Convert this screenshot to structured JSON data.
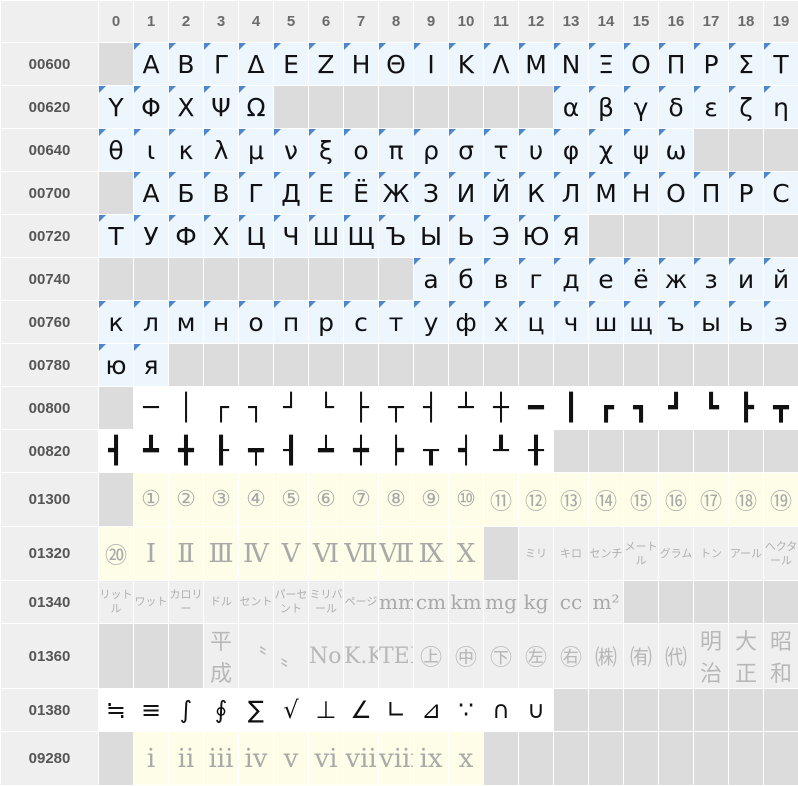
{
  "columns": [
    "0",
    "1",
    "2",
    "3",
    "4",
    "5",
    "6",
    "7",
    "8",
    "9",
    "10",
    "11",
    "12",
    "13",
    "14",
    "15",
    "16",
    "17",
    "18",
    "19"
  ],
  "rows": [
    {
      "label": "00600",
      "kind": "alt",
      "cells": [
        "",
        "Α",
        "Β",
        "Γ",
        "Δ",
        "Ε",
        "Ζ",
        "Η",
        "Θ",
        "Ι",
        "Κ",
        "Λ",
        "Μ",
        "Ν",
        "Ξ",
        "Ο",
        "Π",
        "Ρ",
        "Σ",
        "Τ"
      ]
    },
    {
      "label": "00620",
      "kind": "alt",
      "cells": [
        "Υ",
        "Φ",
        "Χ",
        "Ψ",
        "Ω",
        "",
        "",
        "",
        "",
        "",
        "",
        "",
        "",
        "α",
        "β",
        "γ",
        "δ",
        "ε",
        "ζ",
        "η"
      ]
    },
    {
      "label": "00640",
      "kind": "alt",
      "cells": [
        "θ",
        "ι",
        "κ",
        "λ",
        "μ",
        "ν",
        "ξ",
        "ο",
        "π",
        "ρ",
        "σ",
        "τ",
        "υ",
        "φ",
        "χ",
        "ψ",
        "ω",
        "",
        "",
        ""
      ]
    },
    {
      "label": "00700",
      "kind": "alt",
      "cells": [
        "",
        "А",
        "Б",
        "В",
        "Г",
        "Д",
        "Е",
        "Ё",
        "Ж",
        "З",
        "И",
        "Й",
        "К",
        "Л",
        "М",
        "Н",
        "О",
        "П",
        "Р",
        "С"
      ]
    },
    {
      "label": "00720",
      "kind": "alt",
      "cells": [
        "Т",
        "У",
        "Ф",
        "Х",
        "Ц",
        "Ч",
        "Ш",
        "Щ",
        "Ъ",
        "Ы",
        "Ь",
        "Э",
        "Ю",
        "Я",
        "",
        "",
        "",
        "",
        "",
        ""
      ]
    },
    {
      "label": "00740",
      "kind": "alt",
      "cells": [
        "",
        "",
        "",
        "",
        "",
        "",
        "",
        "",
        "",
        "а",
        "б",
        "в",
        "г",
        "д",
        "е",
        "ё",
        "ж",
        "з",
        "и",
        "й"
      ]
    },
    {
      "label": "00760",
      "kind": "alt",
      "cells": [
        "к",
        "л",
        "м",
        "н",
        "о",
        "п",
        "р",
        "с",
        "т",
        "у",
        "ф",
        "х",
        "ц",
        "ч",
        "ш",
        "щ",
        "ъ",
        "ы",
        "ь",
        "э"
      ]
    },
    {
      "label": "00780",
      "kind": "alt",
      "cells": [
        "ю",
        "я",
        "",
        "",
        "",
        "",
        "",
        "",
        "",
        "",
        "",
        "",
        "",
        "",
        "",
        "",
        "",
        "",
        "",
        ""
      ]
    },
    {
      "label": "00800",
      "kind": "box",
      "cells": [
        "",
        "─",
        "│",
        "┌",
        "┐",
        "┘",
        "└",
        "├",
        "┬",
        "┤",
        "┴",
        "┼",
        "━",
        "┃",
        "┏",
        "┓",
        "┛",
        "┗",
        "┣",
        "┳"
      ]
    },
    {
      "label": "00820",
      "kind": "box",
      "cells": [
        "┫",
        "┻",
        "╋",
        "┠",
        "┯",
        "┨",
        "┷",
        "┿",
        "┝",
        "┰",
        "┥",
        "┸",
        "╂",
        "",
        "",
        "",
        "",
        "",
        "",
        ""
      ]
    },
    {
      "label": "01300",
      "kind": "nec",
      "cells": [
        "",
        "①",
        "②",
        "③",
        "④",
        "⑤",
        "⑥",
        "⑦",
        "⑧",
        "⑨",
        "⑩",
        "⑪",
        "⑫",
        "⑬",
        "⑭",
        "⑮",
        "⑯",
        "⑰",
        "⑱",
        "⑲"
      ]
    },
    {
      "label": "01320",
      "kind": "nec",
      "cells": [
        "⑳",
        "Ⅰ",
        "Ⅱ",
        "Ⅲ",
        "Ⅳ",
        "Ⅴ",
        "Ⅵ",
        "Ⅶ",
        "Ⅷ",
        "Ⅸ",
        "Ⅹ",
        "",
        "ミリ",
        "キロ",
        "センチ",
        "メートル",
        "グラム",
        "トン",
        "アール",
        "ヘクタール"
      ]
    },
    {
      "label": "01340",
      "kind": "nec",
      "cells": [
        "リットル",
        "ワット",
        "カロリー",
        "ドル",
        "セント",
        "パーセント",
        "ミリバール",
        "ページ",
        "mm",
        "cm",
        "km",
        "mg",
        "kg",
        "cc",
        "m²",
        "",
        "",
        "",
        "",
        ""
      ]
    },
    {
      "label": "01360",
      "kind": "nec",
      "cells": [
        "",
        "",
        "",
        "平成",
        "〝",
        "〟",
        "No.",
        "K.K.",
        "TEL",
        "㊤",
        "㊥",
        "㊦",
        "㊧",
        "㊨",
        "㈱",
        "㈲",
        "㈹",
        "明治",
        "大正",
        "昭和"
      ]
    },
    {
      "label": "01380",
      "kind": "math",
      "cells": [
        "≒",
        "≡",
        "∫",
        "∮",
        "∑",
        "√",
        "⊥",
        "∠",
        "∟",
        "⊿",
        "∵",
        "∩",
        "∪",
        "",
        "",
        "",
        "",
        "",
        "",
        ""
      ]
    },
    {
      "label": "09280",
      "kind": "nec",
      "cells": [
        "",
        "ⅰ",
        "ⅱ",
        "ⅲ",
        "ⅳ",
        "ⅴ",
        "ⅵ",
        "ⅶ",
        "ⅷ",
        "ⅸ",
        "ⅹ",
        "",
        "",
        "",
        "",
        "",
        "",
        "",
        "",
        ""
      ]
    }
  ],
  "colors": {
    "header_bg": "#efefef",
    "empty": "#dcdcdc",
    "alt_bg": "#eef6fd",
    "marker": "#4e86cc",
    "nec_bg": "#fdfde8",
    "glyph": "#111111",
    "nec_glyph": "#a9a9a9"
  }
}
